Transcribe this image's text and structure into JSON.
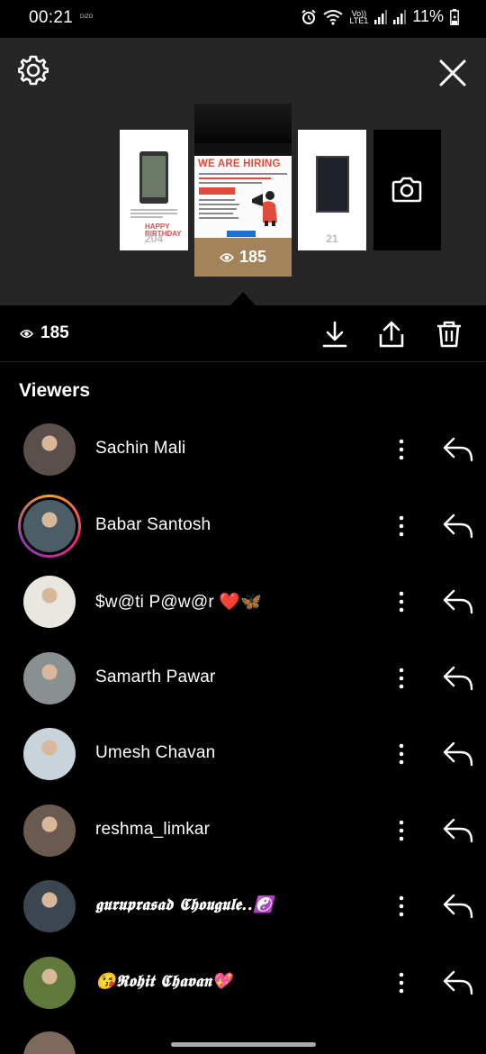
{
  "status_bar": {
    "time": "00:21",
    "carrier": "DIZO",
    "volte_top": "Vo))",
    "volte_bottom": "LTE1",
    "battery": "11%"
  },
  "stories": {
    "thumbs": [
      {
        "count": "204",
        "caption": "HAPPY BIRTHDAY"
      },
      {
        "count": "185",
        "headline": "WE ARE HIRING",
        "subline": "CAMPUS AMBASSADOR PROGRAM",
        "link": "FORMS.GLE"
      },
      {
        "count": "21"
      }
    ]
  },
  "summary": {
    "view_count": "185"
  },
  "viewers": {
    "title": "Viewers",
    "items": [
      {
        "name": "Sachin Mali",
        "avatar_color": "#5a4f4a"
      },
      {
        "name": "Babar Santosh",
        "avatar_color": "#4b5e68",
        "ring": true
      },
      {
        "name": "$w@ti   P@w@r ❤️🦋",
        "avatar_color": "#e9e7e2"
      },
      {
        "name": "Samarth Pawar",
        "avatar_color": "#8a8f92"
      },
      {
        "name": "Umesh Chavan",
        "avatar_color": "#c9d3dc"
      },
      {
        "name": "reshma_limkar",
        "avatar_color": "#6b5a50"
      },
      {
        "name": "𝖌𝖚𝖗𝖚𝖕𝖗𝖆𝖘𝖆𝖉 𝕮𝖍𝖔𝖚𝖌𝖚𝖑𝖊..☯️",
        "avatar_color": "#3c4650",
        "fancy": true
      },
      {
        "name": "😘𝕽𝖔𝖍𝖎𝖙 𝕮𝖍𝖆𝖛𝖆𝖓💖",
        "avatar_color": "#5f7a3a",
        "fancy": true
      }
    ]
  },
  "colors": {
    "background": "#000000",
    "header_bg": "#262626",
    "active_thumb_footer": "#a3845a",
    "ring_gradient": [
      "#f7a21b",
      "#e5267b",
      "#8a3ab9"
    ]
  },
  "icons": [
    "settings-gear-icon",
    "close-icon",
    "eye-icon",
    "camera-icon",
    "download-icon",
    "share-icon",
    "delete-icon",
    "more-vertical-icon",
    "reply-icon"
  ]
}
